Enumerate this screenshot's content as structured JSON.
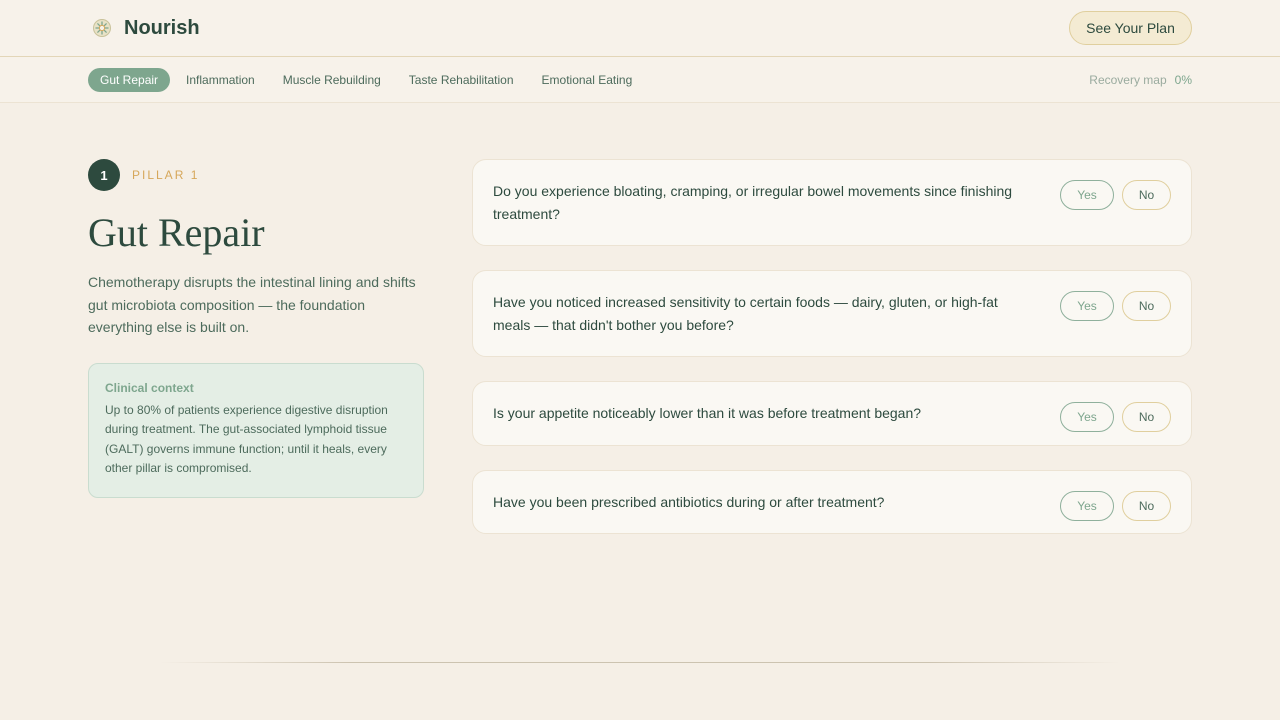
{
  "header": {
    "brand_name": "Nourish",
    "brand_icon": "leaf-wheel-icon",
    "cta_label": "See Your Plan"
  },
  "nav": {
    "tabs": [
      {
        "label": "Gut Repair",
        "active": true
      },
      {
        "label": "Inflammation",
        "active": false
      },
      {
        "label": "Muscle Rebuilding",
        "active": false
      },
      {
        "label": "Taste Rehabilitation",
        "active": false
      },
      {
        "label": "Emotional Eating",
        "active": false
      }
    ],
    "recovery_label": "Recovery map",
    "recovery_value": "0%"
  },
  "pillar": {
    "number": "1",
    "label": "PILLAR 1",
    "title": "Gut Repair",
    "description": "Chemotherapy disrupts the intestinal lining and shifts gut microbiota composition — the foundation everything else is built on.",
    "context_title": "Clinical context",
    "context_body": "Up to 80% of patients experience digestive disruption during treatment. The gut-associated lymphoid tissue (GALT) governs immune function; until it heals, every other pillar is compromised."
  },
  "questions": [
    {
      "text": "Do you experience bloating, cramping, or irregular bowel movements since finishing treatment?",
      "yes_label": "Yes",
      "no_label": "No"
    },
    {
      "text": "Have you noticed increased sensitivity to certain foods — dairy, gluten, or high-fat meals — that didn't bother you before?",
      "yes_label": "Yes",
      "no_label": "No"
    },
    {
      "text": "Is your appetite noticeably lower than it was before treatment began?",
      "yes_label": "Yes",
      "no_label": "No"
    },
    {
      "text": "Have you been prescribed antibiotics during or after treatment?",
      "yes_label": "Yes",
      "no_label": "No"
    }
  ],
  "colors": {
    "background": "#f5efe6",
    "primary_dark": "#2d4a3e",
    "accent_green": "#7ea68e",
    "accent_gold": "#d6a75a"
  }
}
